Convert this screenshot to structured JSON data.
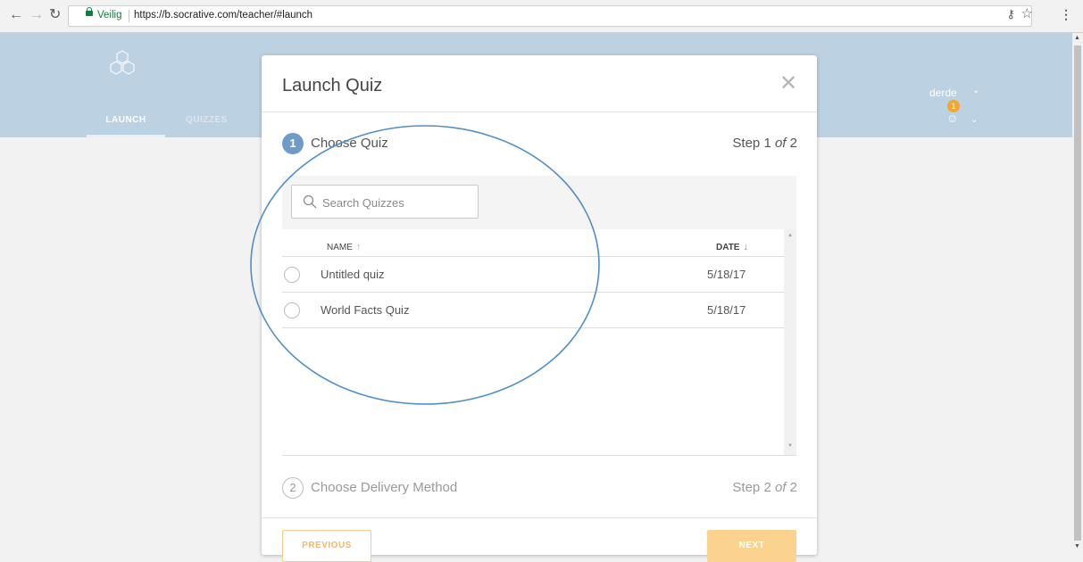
{
  "browser": {
    "secure_label": "Veilig",
    "url": "https://b.socrative.com/teacher/#launch",
    "icons": [
      "back-icon",
      "forward-icon",
      "reload-icon",
      "lock-icon",
      "key-icon",
      "star-icon",
      "menu-icon"
    ]
  },
  "header": {
    "nav": [
      {
        "label": "LAUNCH",
        "active": true
      },
      {
        "label": "QUIZZES",
        "active": false
      }
    ],
    "user_name": "derde",
    "notification_count": "1"
  },
  "modal": {
    "title": "Launch Quiz",
    "step1": {
      "number": "1",
      "label": "Choose Quiz",
      "counter_prefix": "Step 1 ",
      "counter_of": "of",
      "counter_suffix": " 2"
    },
    "search": {
      "placeholder": "Search Quizzes"
    },
    "table": {
      "col_name": "NAME",
      "col_date": "DATE",
      "rows": [
        {
          "name": "Untitled quiz",
          "date": "5/18/17"
        },
        {
          "name": "World Facts Quiz",
          "date": "5/18/17"
        }
      ]
    },
    "step2": {
      "number": "2",
      "label": "Choose Delivery Method",
      "counter_prefix": "Step 2 ",
      "counter_of": "of",
      "counter_suffix": " 2"
    },
    "buttons": {
      "previous": "PREVIOUS",
      "next": "NEXT"
    }
  },
  "colors": {
    "header_bg": "#bcd1e2",
    "accent_blue": "#6e9bc9",
    "accent_orange": "#fbd28e",
    "annotation_ellipse": "#4f8fc9"
  }
}
